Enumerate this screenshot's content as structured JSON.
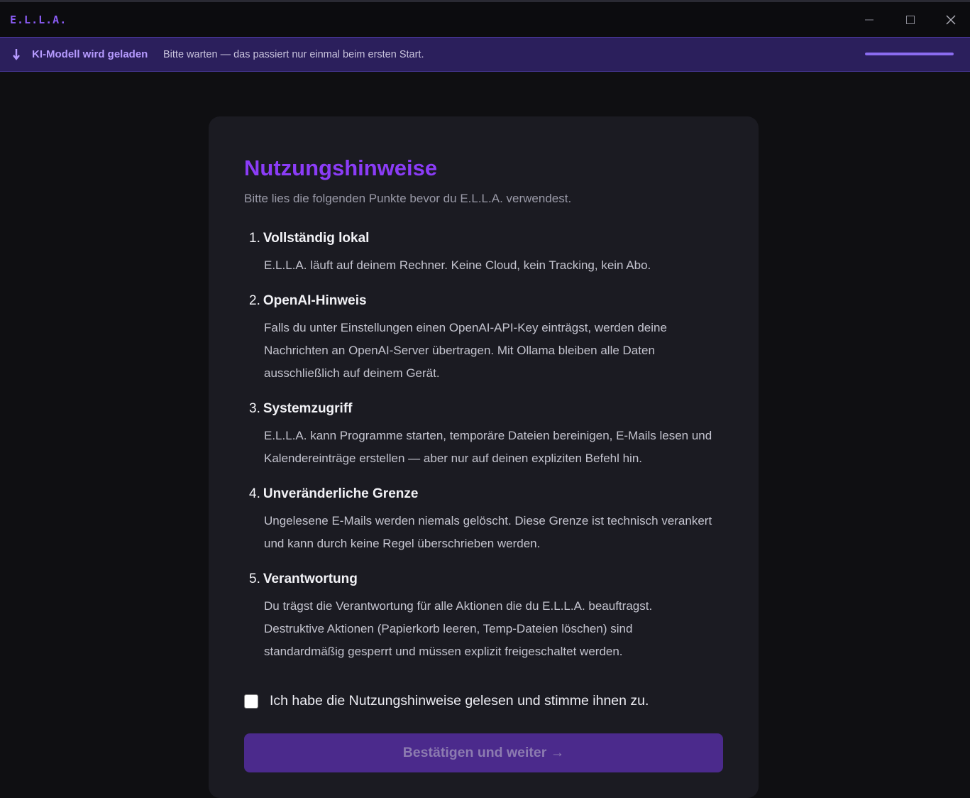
{
  "window": {
    "title": "E.L.L.A.",
    "minimize_icon": "minimize-icon",
    "maximize_icon": "maximize-icon",
    "close_icon": "close-icon"
  },
  "banner": {
    "icon": "download-arrow-icon",
    "title": "KI-Modell wird geladen",
    "text": "Bitte warten — das passiert nur einmal beim ersten Start.",
    "progress": 1.0,
    "accent": "#8b6cf0"
  },
  "card": {
    "title": "Nutzungshinweise",
    "subtitle": "Bitte lies die folgenden Punkte bevor du E.L.L.A. verwendest.",
    "items": [
      {
        "number": "1.",
        "title": "Vollständig lokal",
        "text": "E.L.L.A. läuft auf deinem Rechner. Keine Cloud, kein Tracking, kein Abo."
      },
      {
        "number": "2.",
        "title": "OpenAI-Hinweis",
        "text": "Falls du unter Einstellungen einen OpenAI-API-Key einträgst, werden deine Nachrichten an OpenAI-Server übertragen. Mit Ollama bleiben alle Daten ausschließlich auf deinem Gerät."
      },
      {
        "number": "3.",
        "title": "Systemzugriff",
        "text": "E.L.L.A. kann Programme starten, temporäre Dateien bereinigen, E-Mails lesen und Kalendereinträge erstellen — aber nur auf deinen expliziten Befehl hin."
      },
      {
        "number": "4.",
        "title": "Unveränderliche Grenze",
        "text": "Ungelesene E-Mails werden niemals gelöscht. Diese Grenze ist technisch verankert und kann durch keine Regel überschrieben werden."
      },
      {
        "number": "5.",
        "title": "Verantwortung",
        "text": "Du trägst die Verantwortung für alle Aktionen die du E.L.L.A. beauftragst. Destruktive Aktionen (Papierkorb leeren, Temp-Dateien löschen) sind standardmäßig gesperrt und müssen explizit freigeschaltet werden."
      }
    ],
    "agree_label": "Ich habe die Nutzungshinweise gelesen und stimme ihnen zu.",
    "agree_checked": false,
    "confirm_label": "Bestätigen und weiter →"
  },
  "colors": {
    "accent": "#8b3cf7",
    "banner_bg": "#2b1f5c",
    "card_bg": "#1b1b22",
    "button_bg": "#4b2a8c"
  }
}
